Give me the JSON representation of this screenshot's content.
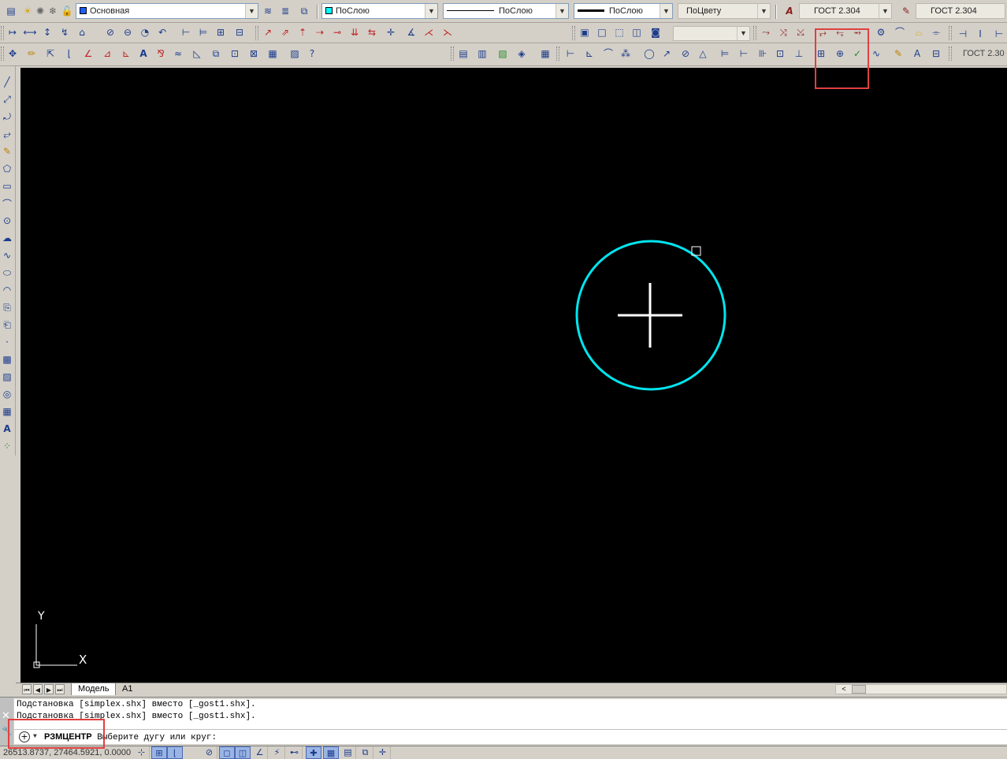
{
  "toolbar_row1": {
    "layer_combo": "Основная",
    "color_combo": "ПоСлою",
    "linetype_combo": "ПоСлою",
    "lineweight_combo": "ПоСлою",
    "plotstyle_combo": "ПоЦвету",
    "textstyle_combo": "ГОСТ 2.304",
    "dimstyle_combo": "ГОСТ 2.304"
  },
  "toolbar_row3": {
    "style_label": "ГОСТ 2.30"
  },
  "tabs": {
    "model": "Модель",
    "layout": "A1"
  },
  "command": {
    "history": [
      "Подстановка [simplex.shx] вместо [_gost1.shx].",
      "Подстановка [simplex.shx] вместо [_gost1.shx]."
    ],
    "current_command": "РЗМЦЕНТР",
    "prompt": "Выберите дугу или круг:"
  },
  "status": {
    "coordinates": "26513.8737, 27464.5921, 0.0000"
  },
  "ucs": {
    "x_label": "X",
    "y_label": "Y"
  },
  "colors": {
    "canvas": "#000000",
    "circle": "#00e5ee",
    "highlight": "#e04040"
  }
}
